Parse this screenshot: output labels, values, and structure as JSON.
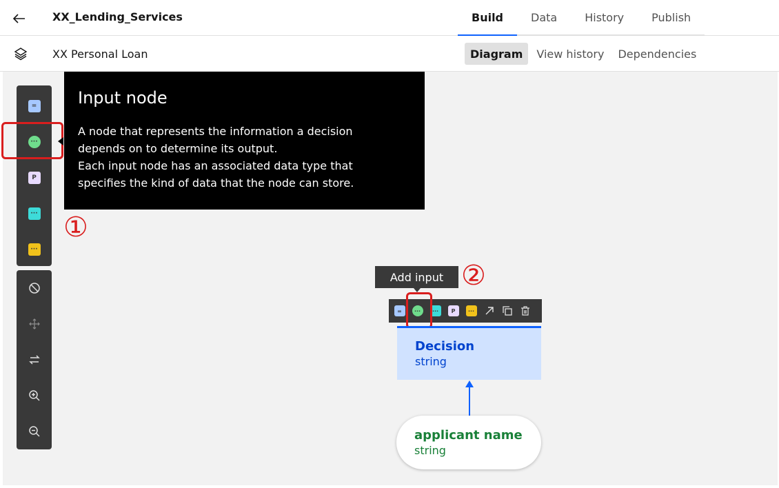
{
  "header": {
    "title": "XX_Lending_Services",
    "tabs": [
      {
        "label": "Build",
        "active": true
      },
      {
        "label": "Data",
        "active": false
      },
      {
        "label": "History",
        "active": false
      },
      {
        "label": "Publish",
        "active": false
      }
    ]
  },
  "subheader": {
    "title": "XX Personal Loan",
    "tabs": [
      {
        "label": "Diagram",
        "active": true
      },
      {
        "label": "View history",
        "active": false
      },
      {
        "label": "Dependencies",
        "active": false
      }
    ]
  },
  "palette": {
    "node_icons": [
      {
        "name": "decision-node-icon",
        "color": "#a6c8ff",
        "glyph": "="
      },
      {
        "name": "input-node-icon",
        "color": "#6fdc8c",
        "glyph": "···"
      },
      {
        "name": "prediction-node-icon",
        "color": "#e8daff",
        "glyph": "P"
      },
      {
        "name": "knowledge-node-icon",
        "color": "#3ddbd9",
        "glyph": "···"
      },
      {
        "name": "annotation-node-icon",
        "color": "#f1c21b",
        "glyph": "···"
      }
    ],
    "tools": [
      "block-icon",
      "move-icon",
      "swap-icon",
      "zoom-in-icon",
      "zoom-out-icon"
    ]
  },
  "tooltip": {
    "title": "Input node",
    "body": "A node that represents the information a decision\ndepends on to determine its output.\nEach input node has an associated data type that\nspecifies the kind of data that the node can store."
  },
  "callouts": {
    "step1": "①",
    "step2": "②"
  },
  "node_toolbar": {
    "tip": "Add input"
  },
  "nodes": {
    "decision": {
      "name": "Decision",
      "type": "string"
    },
    "input": {
      "name": "applicant name",
      "type": "string"
    }
  },
  "colors": {
    "accent": "#0f62fe",
    "highlight": "#d91e1e",
    "palette_bg": "#393939"
  }
}
